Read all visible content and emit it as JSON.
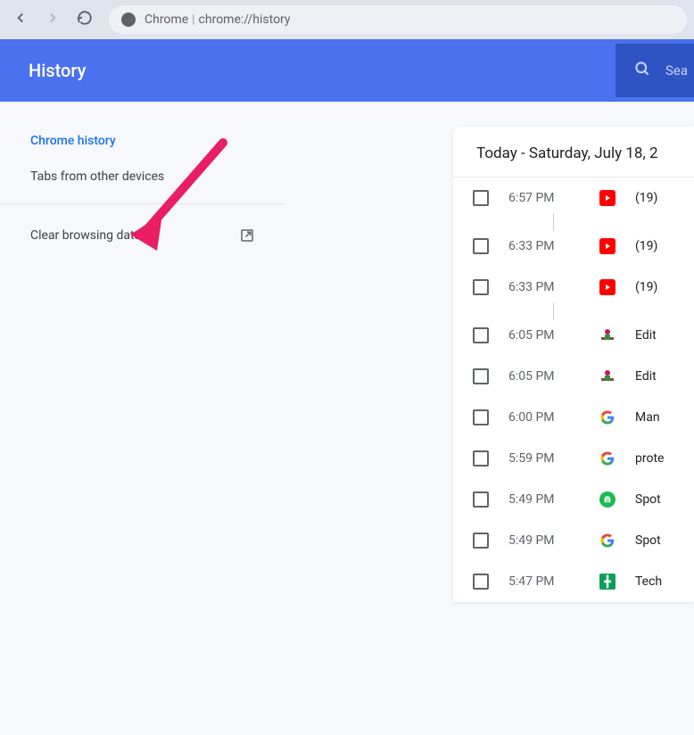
{
  "toolbar": {
    "app_name": "Chrome",
    "url": "chrome://history"
  },
  "header": {
    "title": "History",
    "search_placeholder": "Sea"
  },
  "sidebar": {
    "items": [
      {
        "label": "Chrome history",
        "active": true
      },
      {
        "label": "Tabs from other devices",
        "active": false
      },
      {
        "label": "Clear browsing data",
        "external": true
      }
    ]
  },
  "main": {
    "date_header": "Today - Saturday, July 18, 2",
    "history": [
      {
        "time": "6:57 PM",
        "icon": "youtube",
        "title": "(19)",
        "divider": true
      },
      {
        "time": "6:33 PM",
        "icon": "youtube",
        "title": "(19)"
      },
      {
        "time": "6:33 PM",
        "icon": "youtube",
        "title": "(19)",
        "divider": true
      },
      {
        "time": "6:05 PM",
        "icon": "custom",
        "title": "Edit"
      },
      {
        "time": "6:05 PM",
        "icon": "custom",
        "title": "Edit"
      },
      {
        "time": "6:00 PM",
        "icon": "google",
        "title": "Man"
      },
      {
        "time": "5:59 PM",
        "icon": "google",
        "title": "prote"
      },
      {
        "time": "5:49 PM",
        "icon": "other",
        "title": "Spot"
      },
      {
        "time": "5:49 PM",
        "icon": "google",
        "title": "Spot"
      },
      {
        "time": "5:47 PM",
        "icon": "sheets",
        "title": "Tech"
      }
    ]
  }
}
